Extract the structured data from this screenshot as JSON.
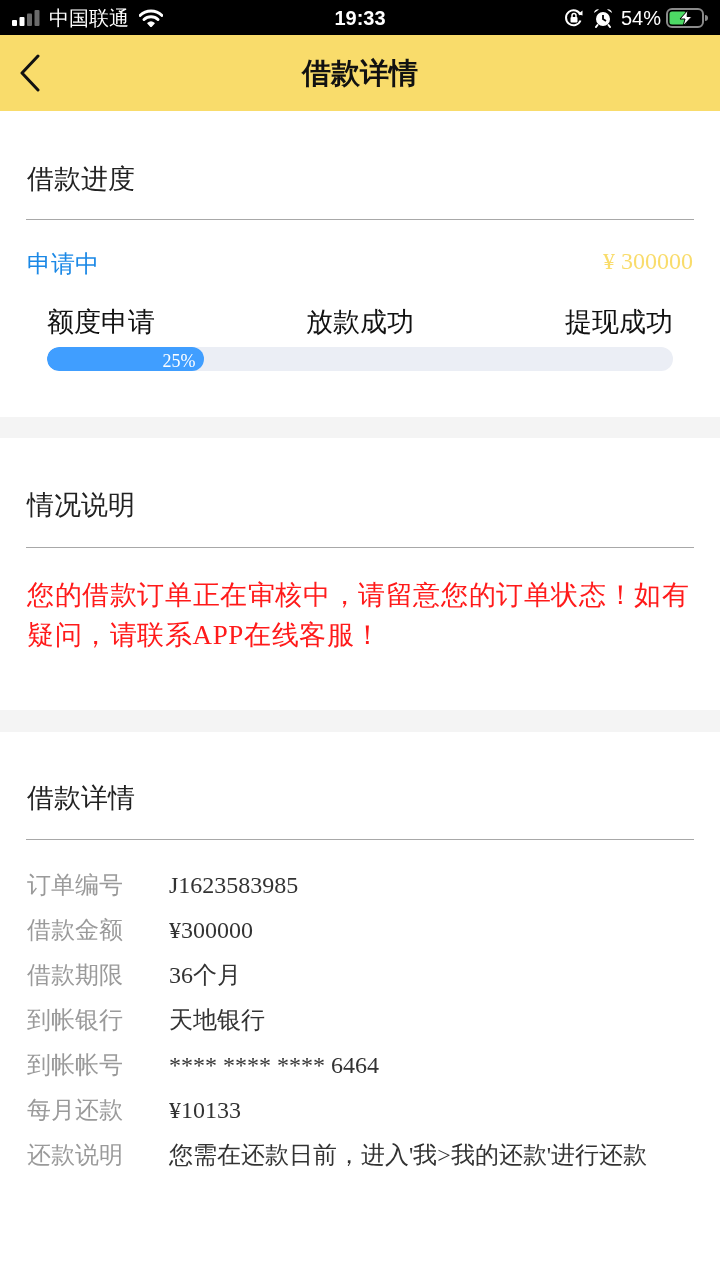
{
  "status_bar": {
    "carrier": "中国联通",
    "time": "19:33",
    "battery": "54%"
  },
  "nav": {
    "title": "借款详情"
  },
  "progress_section": {
    "title": "借款进度",
    "status": "申请中",
    "amount": "¥ 300000",
    "steps": [
      "额度申请",
      "放款成功",
      "提现成功"
    ],
    "progress": {
      "level": 0.25,
      "label": "25%"
    }
  },
  "notice_section": {
    "title": "情况说明",
    "message": "您的借款订单正在审核中，请留意您的订单状态！如有疑问，请联系APP在线客服！"
  },
  "details_section": {
    "title": "借款详情",
    "rows": [
      {
        "label": "订单编号",
        "value": "J1623583985"
      },
      {
        "label": "借款金额",
        "value": "¥300000"
      },
      {
        "label": "借款期限",
        "value": "36个月"
      },
      {
        "label": "到帐银行",
        "value": "天地银行"
      },
      {
        "label": "到帐帐号",
        "value": "**** **** **** 6464"
      },
      {
        "label": "每月还款",
        "value": "¥10133"
      },
      {
        "label": "还款说明",
        "value": "您需在还款日前，进入'我>我的还款'进行还款"
      }
    ]
  }
}
